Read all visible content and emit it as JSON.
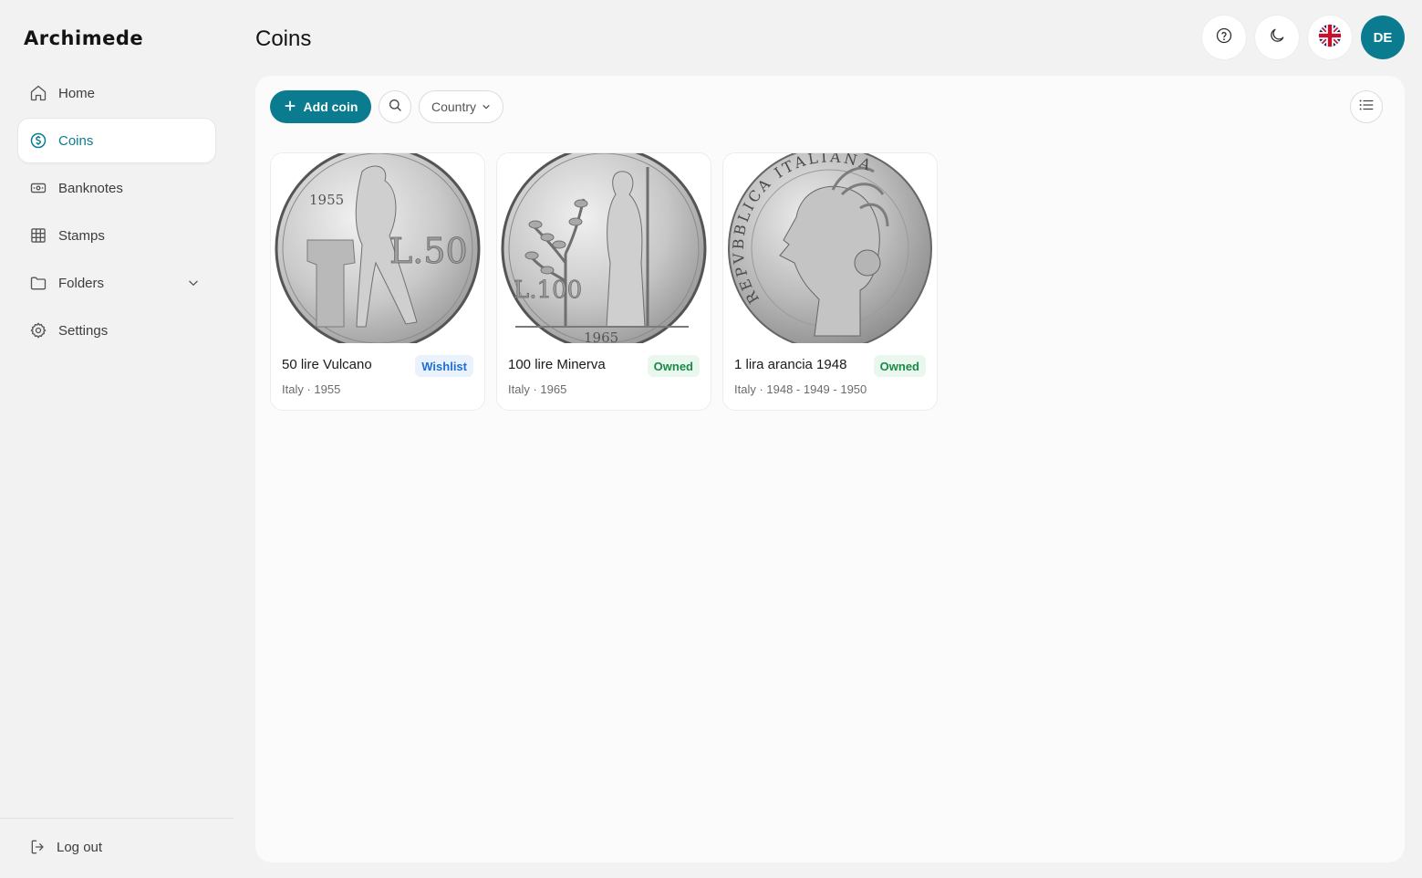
{
  "app": {
    "name": "Archimede"
  },
  "sidebar": {
    "items": [
      {
        "label": "Home",
        "icon": "home-icon",
        "active": false
      },
      {
        "label": "Coins",
        "icon": "coin-icon",
        "active": true
      },
      {
        "label": "Banknotes",
        "icon": "banknote-icon",
        "active": false
      },
      {
        "label": "Stamps",
        "icon": "grid-icon",
        "active": false
      },
      {
        "label": "Folders",
        "icon": "folder-icon",
        "active": false,
        "expandable": true
      },
      {
        "label": "Settings",
        "icon": "gear-icon",
        "active": false
      }
    ],
    "logout_label": "Log out"
  },
  "header": {
    "title": "Coins",
    "avatar_initials": "DE",
    "actions": [
      "help-icon",
      "moon-icon",
      "uk-flag-icon"
    ]
  },
  "toolbar": {
    "add_label": "Add coin",
    "country_label": "Country"
  },
  "coins": [
    {
      "name": "50 lire Vulcano",
      "status": "Wishlist",
      "meta": "Italy · 1955",
      "coin_text": "L.50",
      "coin_year": "1955"
    },
    {
      "name": "100 lire Minerva",
      "status": "Owned",
      "meta": "Italy · 1965",
      "coin_text": "L.100",
      "coin_year": "1965"
    },
    {
      "name": "1 lira arancia 1948",
      "status": "Owned",
      "meta": "Italy · 1948 - 1949 - 1950",
      "coin_text": "REPVBBLICA ITALIANA",
      "coin_year": ""
    }
  ],
  "colors": {
    "accent": "#0b7c8f",
    "wishlist_bg": "#eaf2fd",
    "wishlist_text": "#1f6fd6",
    "owned_bg": "#eaf7ee",
    "owned_text": "#1a8a45"
  }
}
